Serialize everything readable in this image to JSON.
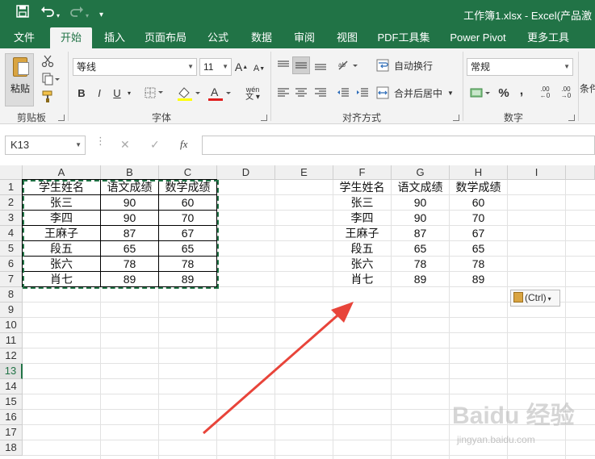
{
  "window": {
    "title": "工作簿1.xlsx - Excel(产品激"
  },
  "ribbon_tabs": [
    "文件",
    "开始",
    "插入",
    "页面布局",
    "公式",
    "数据",
    "审阅",
    "视图",
    "PDF工具集",
    "Power Pivot",
    "更多工具"
  ],
  "active_tab": "开始",
  "clipboard_group": {
    "paste_label": "粘贴",
    "label": "剪贴板"
  },
  "font_group": {
    "font_name": "等线",
    "font_size": "11",
    "label": "字体",
    "bold": "B",
    "italic": "I",
    "underline": "U",
    "grow": "A",
    "shrink": "A",
    "phonetic": "wén"
  },
  "alignment_group": {
    "wrap_text": "自动换行",
    "merge_center": "合并后居中",
    "label": "对齐方式"
  },
  "number_group": {
    "format": "常规",
    "percent": "%",
    "comma": ",",
    "inc_decimal": ".00",
    "dec_decimal": ".00",
    "label": "数字"
  },
  "styles_group": {
    "conditional": "条件"
  },
  "formula_bar": {
    "name_box": "K13",
    "cancel": "✕",
    "enter": "✓",
    "fx": "fx",
    "formula": ""
  },
  "columns": [
    "A",
    "B",
    "C",
    "D",
    "E",
    "F",
    "G",
    "H",
    "I"
  ],
  "rows": [
    "1",
    "2",
    "3",
    "4",
    "5",
    "6",
    "7",
    "8",
    "9",
    "10",
    "11",
    "12",
    "13",
    "14",
    "15",
    "16",
    "17",
    "18"
  ],
  "selected_row": "13",
  "table_source": {
    "headers": [
      "学生姓名",
      "语文成绩",
      "数学成绩"
    ],
    "rows": [
      [
        "张三",
        "90",
        "60"
      ],
      [
        "李四",
        "90",
        "70"
      ],
      [
        "王麻子",
        "87",
        "67"
      ],
      [
        "段五",
        "65",
        "65"
      ],
      [
        "张六",
        "78",
        "78"
      ],
      [
        "肖七",
        "89",
        "89"
      ]
    ]
  },
  "table_pasted": {
    "headers": [
      "学生姓名",
      "语文成绩",
      "数学成绩"
    ],
    "rows": [
      [
        "张三",
        "90",
        "60"
      ],
      [
        "李四",
        "90",
        "70"
      ],
      [
        "王麻子",
        "87",
        "67"
      ],
      [
        "段五",
        "65",
        "65"
      ],
      [
        "张六",
        "78",
        "78"
      ],
      [
        "肖七",
        "89",
        "89"
      ]
    ]
  },
  "paste_options": {
    "label": "(Ctrl)"
  },
  "watermark": {
    "text": "Baidu 经验",
    "sub": "jingyan.baidu.com"
  },
  "colors": {
    "accent": "#217346",
    "arrow": "#e8443a"
  }
}
